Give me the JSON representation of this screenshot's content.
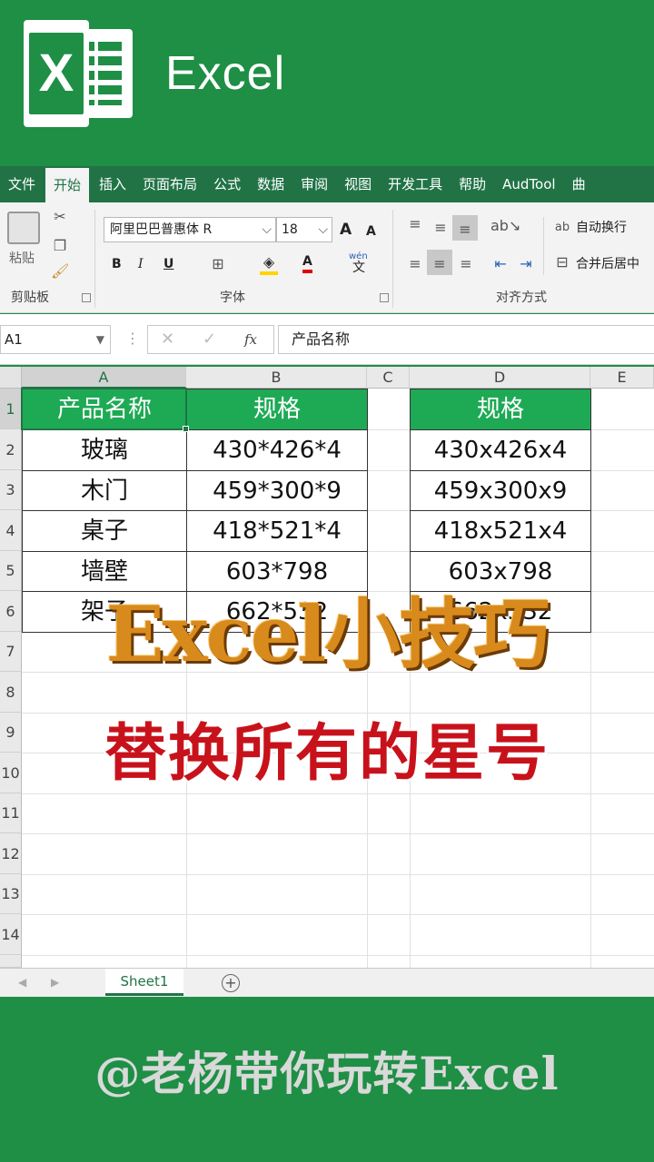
{
  "app": {
    "name": "Excel",
    "logo_letter": "X"
  },
  "ribbon": {
    "tabs": [
      "文件",
      "开始",
      "插入",
      "页面布局",
      "公式",
      "数据",
      "审阅",
      "视图",
      "开发工具",
      "帮助",
      "AudTool",
      "曲"
    ],
    "active_tab": "开始",
    "clipboard": {
      "paste_label": "粘贴",
      "group_label": "剪贴板"
    },
    "font": {
      "family": "阿里巴巴普惠体 R",
      "size": "18",
      "bold": "B",
      "italic": "I",
      "underline": "U",
      "grow": "A",
      "shrink": "A",
      "font_color": "A",
      "phonetic_top": "wén",
      "phonetic_bottom": "文",
      "group_label": "字体"
    },
    "alignment": {
      "wrap_text": "自动换行",
      "merge_center": "合并后居中",
      "group_label": "对齐方式"
    }
  },
  "formula_bar": {
    "name_box": "A1",
    "fx": "fx",
    "content": "产品名称"
  },
  "grid": {
    "columns": [
      "A",
      "B",
      "C",
      "D",
      "E"
    ],
    "rows": [
      "1",
      "2",
      "3",
      "4",
      "5",
      "6",
      "7",
      "8",
      "9",
      "10",
      "11",
      "12",
      "13",
      "14"
    ],
    "header_a": "产品名称",
    "header_b": "规格",
    "header_d": "规格",
    "col_a": [
      "玻璃",
      "木门",
      "桌子",
      "墙壁",
      "架子"
    ],
    "col_b": [
      "430*426*4",
      "459*300*9",
      "418*521*4",
      "603*798",
      "662*532"
    ],
    "col_d": [
      "430x426x4",
      "459x300x9",
      "418x521x4",
      "603x798",
      "662x532"
    ]
  },
  "sheets": {
    "active": "Sheet1",
    "add": "+"
  },
  "overlay": {
    "title": "Excel小技巧",
    "subtitle": "替换所有的星号"
  },
  "watermark": "@老杨带你玩转Excel",
  "colors": {
    "brand_green": "#1e8f45",
    "header_fill": "#1eaa55",
    "title_orange": "#d88a1c",
    "subtitle_red": "#c8121b"
  }
}
